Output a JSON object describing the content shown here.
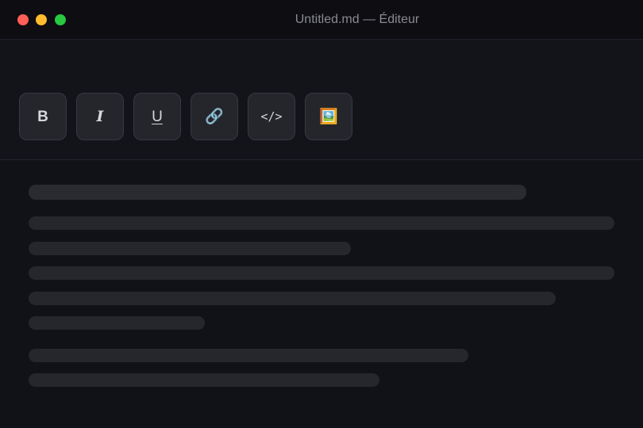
{
  "window": {
    "title": "Untitled.md — Éditeur"
  },
  "toolbar": {
    "buttons": [
      {
        "glyph": "B",
        "icon": "bold-icon"
      },
      {
        "glyph": "I",
        "icon": "italic-icon"
      },
      {
        "glyph": "U",
        "icon": "underline-icon"
      },
      {
        "glyph": "🔗",
        "icon": "link-icon"
      },
      {
        "glyph": "</>",
        "icon": "code-icon"
      },
      {
        "glyph": "🖼️",
        "icon": "image-icon"
      }
    ]
  },
  "colors": {
    "background": "#111118",
    "titlebar": "#0d0d12",
    "button_bg": "#25252c",
    "button_border": "#383840",
    "skeleton": "#26262d",
    "close": "#ff5f57",
    "minimize": "#febc2e",
    "zoom": "#28c840"
  }
}
